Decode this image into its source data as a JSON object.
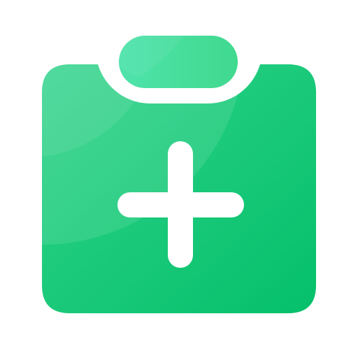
{
  "icon": {
    "name": "clipboard-plus-icon",
    "colors": {
      "background": "#ffffff",
      "green_dark": "#0bc26d",
      "green_mid": "#3fd98f",
      "green_light": "#4de3aa",
      "symbol": "#ffffff"
    }
  }
}
